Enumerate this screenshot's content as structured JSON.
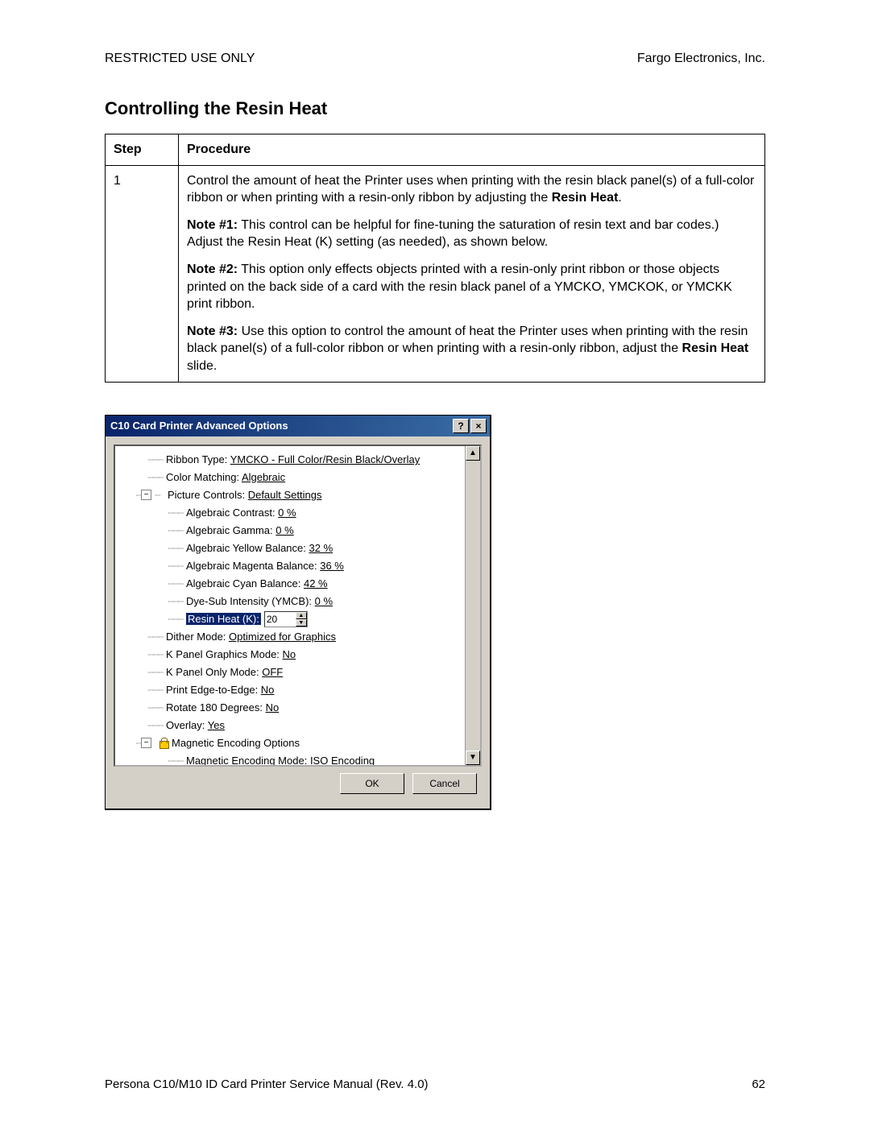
{
  "header": {
    "left": "RESTRICTED USE ONLY",
    "right": "Fargo Electronics, Inc."
  },
  "section_title": "Controlling the Resin Heat",
  "table": {
    "headers": {
      "step": "Step",
      "procedure": "Procedure"
    },
    "step_num": "1",
    "p1_a": "Control the amount of heat the Printer uses when printing with the resin black panel(s) of a full-color ribbon or when printing with a resin-only ribbon by adjusting the ",
    "p1_b": "Resin Heat",
    "p1_c": ".",
    "n1_label": "Note #1:",
    "n1_text": "  This control can be helpful for fine-tuning the saturation of resin text and bar codes.)  Adjust the Resin Heat (K) setting (as needed), as shown below.",
    "n2_label": "Note #2:",
    "n2_text": "  This option only effects objects printed with a resin-only print ribbon or those objects printed on the back side of a card with the resin black panel of a YMCKO, YMCKOK, or YMCKK print ribbon.",
    "n3_label": "Note #3:",
    "n3_a": "  Use this option to control the amount of heat the Printer uses when printing with the resin black panel(s) of a full-color ribbon or when printing with a resin-only ribbon, adjust the ",
    "n3_b": "Resin Heat",
    "n3_c": " slide."
  },
  "dialog": {
    "title": "C10 Card Printer Advanced Options",
    "help_glyph": "?",
    "close_glyph": "×",
    "scroll_up": "▲",
    "scroll_down": "▼",
    "spin_up": "▲",
    "spin_down": "▼",
    "tree": {
      "ribbon_type_label": "Ribbon Type: ",
      "ribbon_type_value": "YMCKO - Full Color/Resin Black/Overlay",
      "color_matching_label": "Color Matching: ",
      "color_matching_value": "Algebraic",
      "picture_controls_label": "Picture Controls: ",
      "picture_controls_value": "Default Settings",
      "alg_contrast_label": "Algebraic Contrast: ",
      "alg_contrast_value": "0 %",
      "alg_gamma_label": "Algebraic Gamma: ",
      "alg_gamma_value": "0 %",
      "alg_yellow_label": "Algebraic Yellow Balance: ",
      "alg_yellow_value": "32 %",
      "alg_magenta_label": "Algebraic Magenta Balance: ",
      "alg_magenta_value": "36 %",
      "alg_cyan_label": "Algebraic Cyan Balance: ",
      "alg_cyan_value": "42 %",
      "dyesub_label": "Dye-Sub Intensity (YMCB): ",
      "dyesub_value": "0 %",
      "resin_heat_label": "Resin Heat (K): ",
      "resin_heat_value": "20",
      "dither_label": "Dither Mode: ",
      "dither_value": "Optimized for Graphics",
      "kpanel_gfx_label": "K Panel Graphics Mode: ",
      "kpanel_gfx_value": "No",
      "kpanel_only_label": "K Panel Only Mode: ",
      "kpanel_only_value": "OFF",
      "edge_label": "Print Edge-to-Edge: ",
      "edge_value": "No",
      "rotate_label": "Rotate 180 Degrees: ",
      "rotate_value": "No",
      "overlay_label": "Overlay: ",
      "overlay_value": "Yes",
      "mag_opts_label": "Magnetic Encoding Options",
      "mag_mode_label": "Magnetic Encoding Mode: ",
      "mag_mode_value": "ISO Encoding",
      "minus_glyph": "−"
    },
    "buttons": {
      "ok": "OK",
      "cancel": "Cancel"
    }
  },
  "footer": {
    "left": "Persona C10/M10 ID Card Printer Service Manual (Rev. 4.0)",
    "page": "62"
  }
}
